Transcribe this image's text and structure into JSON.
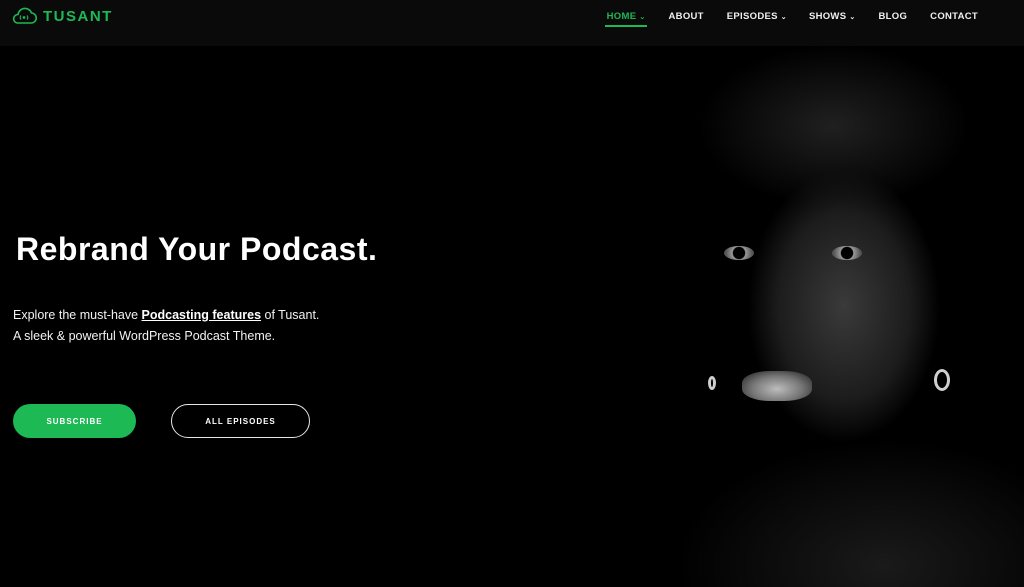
{
  "brand": {
    "name": "TUSANT",
    "logo_icon": "cloud-broadcast-icon",
    "accent_color": "#1db954"
  },
  "nav": {
    "items": [
      {
        "label": "HOME",
        "has_dropdown": true,
        "active": true
      },
      {
        "label": "ABOUT",
        "has_dropdown": false
      },
      {
        "label": "EPISODES",
        "has_dropdown": true
      },
      {
        "label": "SHOWS",
        "has_dropdown": true
      },
      {
        "label": "BLOG",
        "has_dropdown": false
      },
      {
        "label": "CONTACT",
        "has_dropdown": false
      }
    ],
    "dropdown_icon": "⌄"
  },
  "hero": {
    "title": "Rebrand Your Podcast.",
    "desc_line1_pre": "Explore the must-have ",
    "desc_link": "Podcasting features",
    "desc_line1_post": " of Tusant.",
    "desc_line2": "A sleek & powerful WordPress Podcast Theme.",
    "subscribe_label": "SUBSCRIBE",
    "episodes_label": "ALL EPISODES",
    "image_alt": "Black and white portrait of a man with earrings"
  }
}
